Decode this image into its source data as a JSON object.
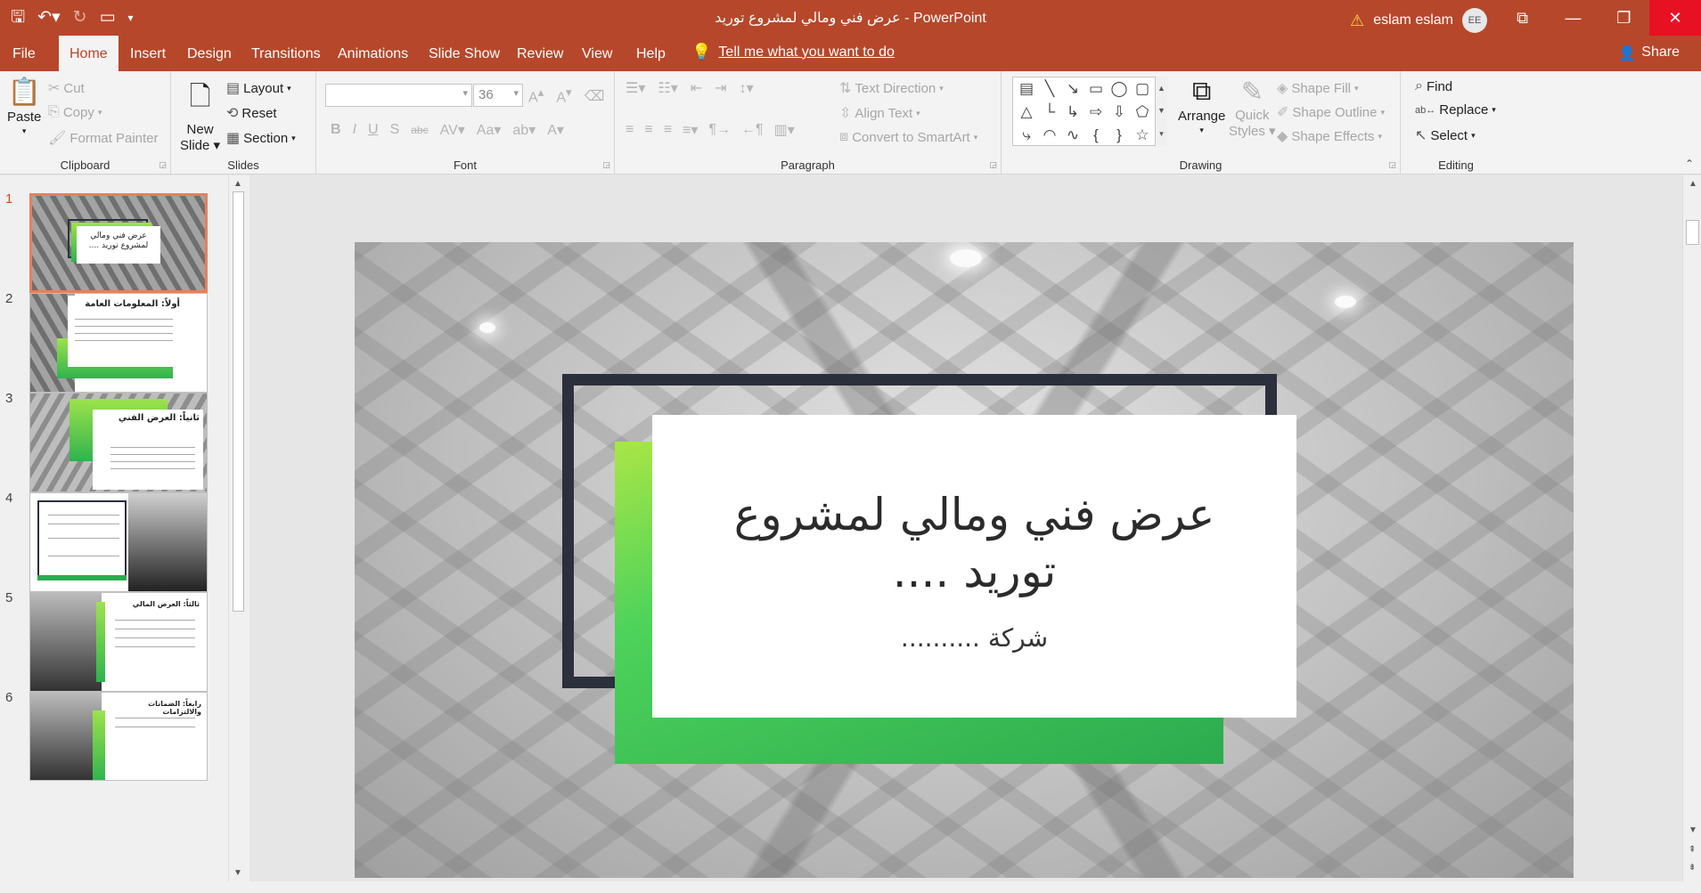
{
  "app": {
    "window_title": "عرض فني ومالي  لمشروع توريد  -  PowerPoint",
    "user_name": "eslam eslam",
    "user_initials": "EE",
    "share_label": "Share",
    "tell_me": "Tell me what you want to do"
  },
  "tabs": [
    "File",
    "Home",
    "Insert",
    "Design",
    "Transitions",
    "Animations",
    "Slide Show",
    "Review",
    "View",
    "Help"
  ],
  "ribbon": {
    "clipboard": {
      "label": "Clipboard",
      "paste": "Paste",
      "cut": "Cut",
      "copy": "Copy",
      "format_painter": "Format Painter"
    },
    "slides": {
      "label": "Slides",
      "new_slide_1": "New",
      "new_slide_2": "Slide",
      "layout": "Layout",
      "reset": "Reset",
      "section": "Section"
    },
    "font": {
      "label": "Font",
      "font_name": "",
      "font_size": "36"
    },
    "paragraph": {
      "label": "Paragraph",
      "text_direction": "Text Direction",
      "align_text": "Align Text",
      "convert_smartart": "Convert to SmartArt"
    },
    "drawing": {
      "label": "Drawing",
      "arrange": "Arrange",
      "quick_styles_1": "Quick",
      "quick_styles_2": "Styles",
      "shape_fill": "Shape Fill",
      "shape_outline": "Shape Outline",
      "shape_effects": "Shape Effects"
    },
    "editing": {
      "label": "Editing",
      "find": "Find",
      "replace": "Replace",
      "select": "Select"
    }
  },
  "thumbnails": [
    {
      "number": "1",
      "title": "عرض فني ومالي  لمشروع توريد ...."
    },
    {
      "number": "2",
      "title": "أولاً: المعلومات العامة"
    },
    {
      "number": "3",
      "title": "ثانياً: العرض الفني"
    },
    {
      "number": "4",
      "title": ""
    },
    {
      "number": "5",
      "title": "ثالثاً: العرض المالي"
    },
    {
      "number": "6",
      "title": "رابعاً: الضمانات والالتزامات"
    }
  ],
  "slide": {
    "title_line1": "عرض فني ومالي  لمشروع",
    "title_line2": "توريد ....",
    "subtitle": "شركة  ..........",
    "accent_green": "#2cab4f",
    "frame_color": "#2c2f3c"
  }
}
